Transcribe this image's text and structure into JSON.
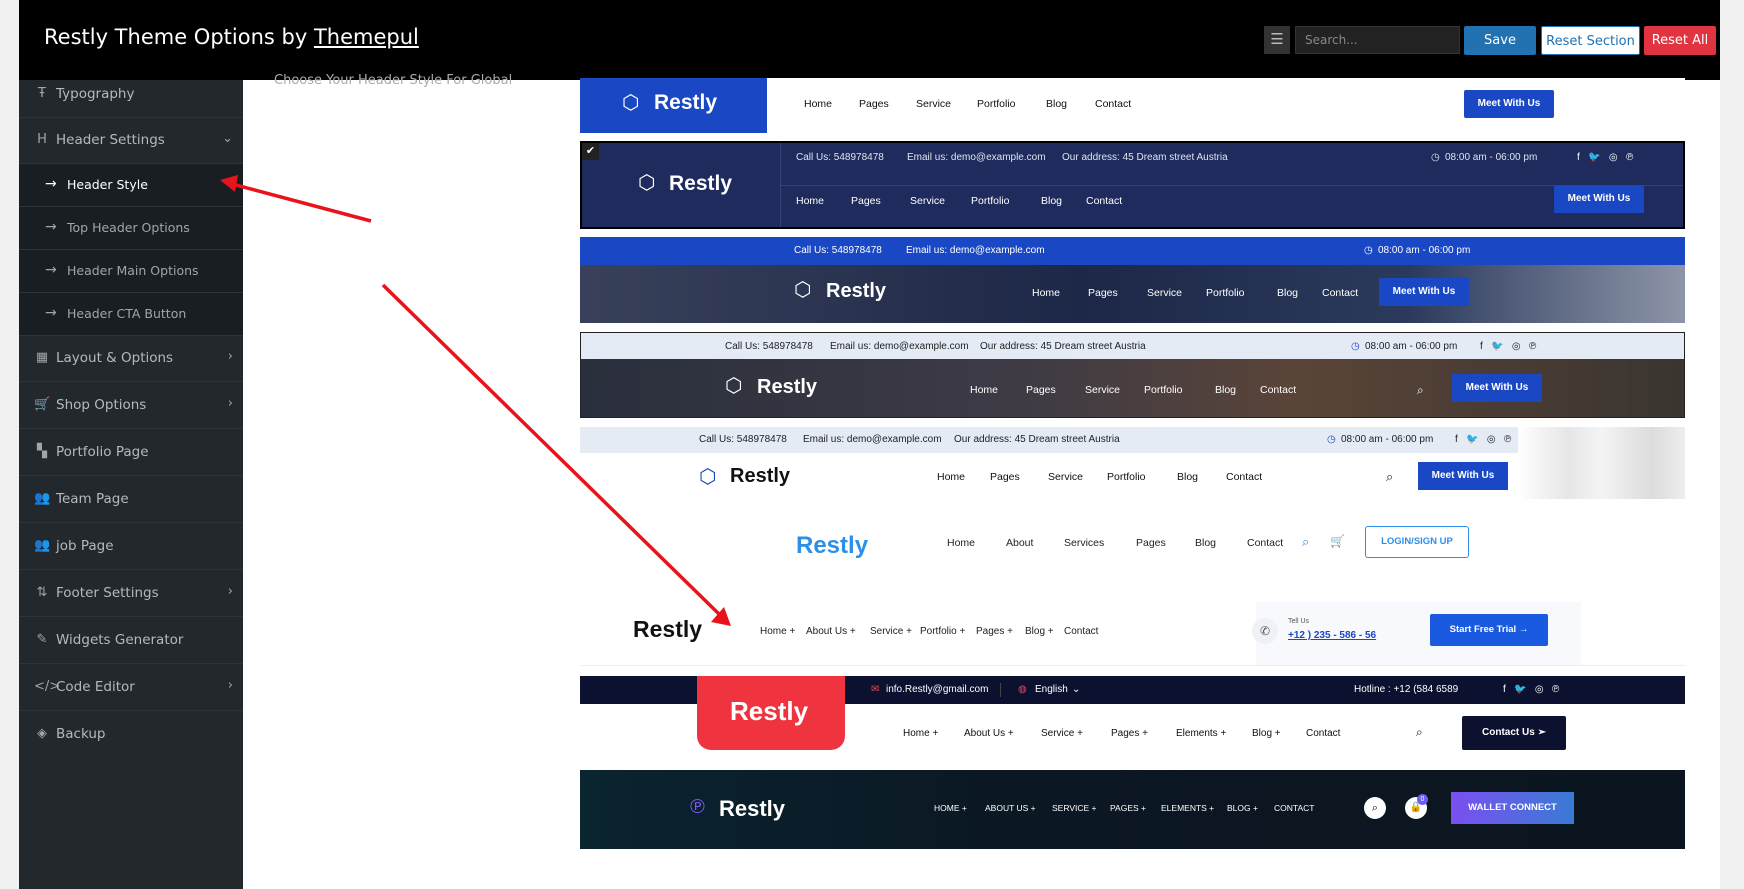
{
  "topbar": {
    "title_prefix": "Restly Theme Options by",
    "title_link": "Themepul",
    "search_placeholder": "Search...",
    "save_label": "Save",
    "reset_section_label": "Reset Section",
    "reset_all_label": "Reset All",
    "expand_icon": "list-expand-icon"
  },
  "sidebar": {
    "items": [
      {
        "label": "Typography",
        "icon": "typography-icon"
      },
      {
        "label": "Header Settings",
        "icon": "heading-icon"
      },
      {
        "label": "Layout & Options",
        "icon": "calculator-icon"
      },
      {
        "label": "Shop Options",
        "icon": "cart-icon"
      },
      {
        "label": "Portfolio Page",
        "icon": "grid-icon"
      },
      {
        "label": "Team Page",
        "icon": "users-icon"
      },
      {
        "label": "job Page",
        "icon": "users-icon"
      },
      {
        "label": "Footer Settings",
        "icon": "sort-icon"
      },
      {
        "label": "Widgets Generator",
        "icon": "wrench-icon"
      },
      {
        "label": "Code Editor",
        "icon": "code-icon"
      },
      {
        "label": "Backup",
        "icon": "shield-icon"
      }
    ],
    "sub_items": [
      {
        "label": "Header Style"
      },
      {
        "label": "Top Header Options"
      },
      {
        "label": "Header Main Options"
      },
      {
        "label": "Header CTA Button"
      }
    ]
  },
  "main": {
    "field_description": "Choose Your Header Style For Global"
  },
  "headers": {
    "brand": "Restly",
    "nav_basic": [
      "Home",
      "Pages",
      "Service",
      "Portfolio",
      "Blog",
      "Contact"
    ],
    "cta_meet": "Meet With Us",
    "call": "Call Us: 548978478",
    "email": "Email us: demo@example.com",
    "address": "Our address: 45 Dream street Austria",
    "hours": "08:00 am - 06:00 pm",
    "nav_six": [
      "Home",
      "About",
      "Services",
      "Pages",
      "Blog",
      "Contact"
    ],
    "login": "LOGIN/SIGN UP",
    "nav_seven": [
      "Home +",
      "About Us +",
      "Service +",
      "Portfolio +",
      "Pages +",
      "Blog +",
      "Contact"
    ],
    "tell_us": "Tell Us",
    "phone": "+12 ) 235 - 586 - 56",
    "free_trial": "Start Free Trial →",
    "mail8": "info.Restly@gmail.com",
    "lang": "English",
    "hotline": "Hotline : +12 (584 6589",
    "nav_eight": [
      "Home +",
      "About Us +",
      "Service +",
      "Pages +",
      "Elements +",
      "Blog +",
      "Contact"
    ],
    "contact_us": "Contact Us",
    "nav_nine": [
      "HOME +",
      "ABOUT US +",
      "SERVICE +",
      "PAGES +",
      "ELEMENTS +",
      "BLOG +",
      "CONTACT"
    ],
    "wallet": "WALLET CONNECT",
    "cart_count": "0"
  },
  "colors": {
    "accent": "#2271b1",
    "danger": "#e03540",
    "brand_blue": "#1a48c4",
    "navy": "#1e2b5c"
  }
}
